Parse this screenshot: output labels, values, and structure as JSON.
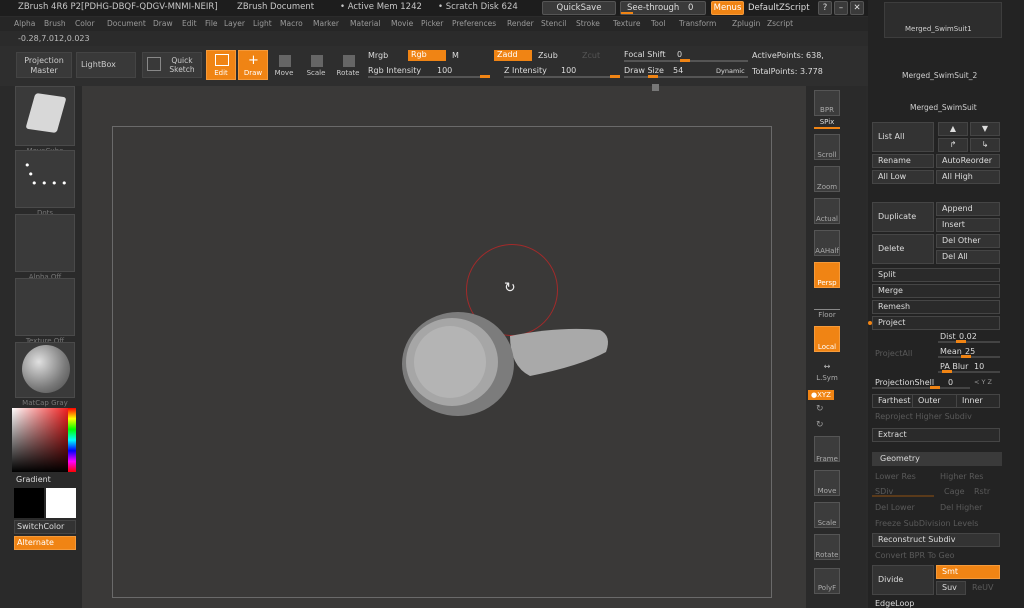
{
  "title_bar": {
    "app": "ZBrush 4R6 P2[PDHG-DBQF-QDGV-MNMI-NEIR]",
    "document": "ZBrush Document",
    "active_mem": "• Active Mem 1242",
    "scratch_disk": "• Scratch Disk 624",
    "quicksave": "QuickSave",
    "see_through": "See-through",
    "see_through_value": "0",
    "menus": "Menus",
    "script": "DefaultZScript"
  },
  "menubar": [
    "Alpha",
    "Brush",
    "Color",
    "Document",
    "Draw",
    "Edit",
    "File",
    "Layer",
    "Light",
    "Macro",
    "Marker",
    "Material",
    "Movie",
    "Picker",
    "Preferences",
    "Render",
    "Stencil",
    "Stroke",
    "Texture",
    "Tool",
    "Transform",
    "Zplugin",
    "Zscript"
  ],
  "coords": "-0.28,7.012,0.023",
  "toolbar": {
    "projection_master": "Projection Master",
    "lightbox": "LightBox",
    "quick_sketch": "Quick Sketch",
    "edit": "Edit",
    "draw": "Draw",
    "move": "Move",
    "scale": "Scale",
    "rotate": "Rotate",
    "mrgb": "Mrgb",
    "rgb": "Rgb",
    "m": "M",
    "zadd": "Zadd",
    "zsub": "Zsub",
    "zcut": "Zcut",
    "rgb_intensity_label": "Rgb Intensity",
    "rgb_intensity_value": "100",
    "z_intensity_label": "Z Intensity",
    "z_intensity_value": "100",
    "focal_shift_label": "Focal Shift",
    "focal_shift_value": "0",
    "draw_size_label": "Draw Size",
    "draw_size_value": "54",
    "dynamic": "Dynamic",
    "active_points": "ActivePoints: 638,",
    "total_points": "TotalPoints: 3.778"
  },
  "left_panel": {
    "brush_caption": "MoveCube",
    "stroke_caption": "Dots",
    "alpha_caption": "Alpha Off",
    "texture_caption": "Texture Off",
    "material_caption": "MatCap Gray",
    "gradient": "Gradient",
    "switch_color": "SwitchColor",
    "alternate": "Alternate"
  },
  "right_shelf": {
    "bpr": "BPR",
    "spix": "SPix",
    "scroll": "Scroll",
    "zoom": "Zoom",
    "actual": "Actual",
    "aahalf": "AAHalf",
    "persp": "Persp",
    "floor": "Floor",
    "local": "Local",
    "lsym": "L.Sym",
    "xyz": "●XYZ",
    "frame": "Frame",
    "move": "Move",
    "scale": "Scale",
    "rotate": "Rotate",
    "polyf": "PolyF"
  },
  "subtools": [
    "Merged_SwimSuit1",
    "Merged_SwimSuit_2",
    "Merged_SwimSuit"
  ],
  "subtool_panel": {
    "list_all": "List All",
    "rename": "Rename",
    "auto_reorder": "AutoReorder",
    "all_low": "All Low",
    "all_high": "All High",
    "duplicate": "Duplicate",
    "append": "Append",
    "insert": "Insert",
    "delete": "Delete",
    "del_other": "Del Other",
    "del_all": "Del All",
    "split": "Split",
    "merge": "Merge",
    "remesh": "Remesh",
    "project": "Project",
    "projectall": "ProjectAll",
    "dist_label": "Dist",
    "dist_value": "0.02",
    "mean_label": "Mean",
    "mean_value": "25",
    "pa_blur_label": "PA Blur",
    "pa_blur_value": "10",
    "projection_shell_label": "ProjectionShell",
    "projection_shell_value": "0",
    "xyz_small": "< Y Z",
    "farthest": "Farthest",
    "outer": "Outer",
    "inner": "Inner",
    "reproject_higher_subdiv": "Reproject Higher Subdiv",
    "extract": "Extract"
  },
  "geometry_panel": {
    "header": "Geometry",
    "lower_res": "Lower Res",
    "higher_res": "Higher Res",
    "sdiv": "SDiv",
    "cage": "Cage",
    "rstr": "Rstr",
    "del_lower": "Del Lower",
    "del_higher": "Del Higher",
    "freeze_subdivision_levels": "Freeze SubDivision Levels",
    "reconstruct_subdiv": "Reconstruct Subdiv",
    "convert_bpr": "Convert BPR To Geo",
    "divide": "Divide",
    "smt": "Smt",
    "suv": "Suv",
    "reuv": "ReUV",
    "edgeloop": "EdgeLoop"
  }
}
